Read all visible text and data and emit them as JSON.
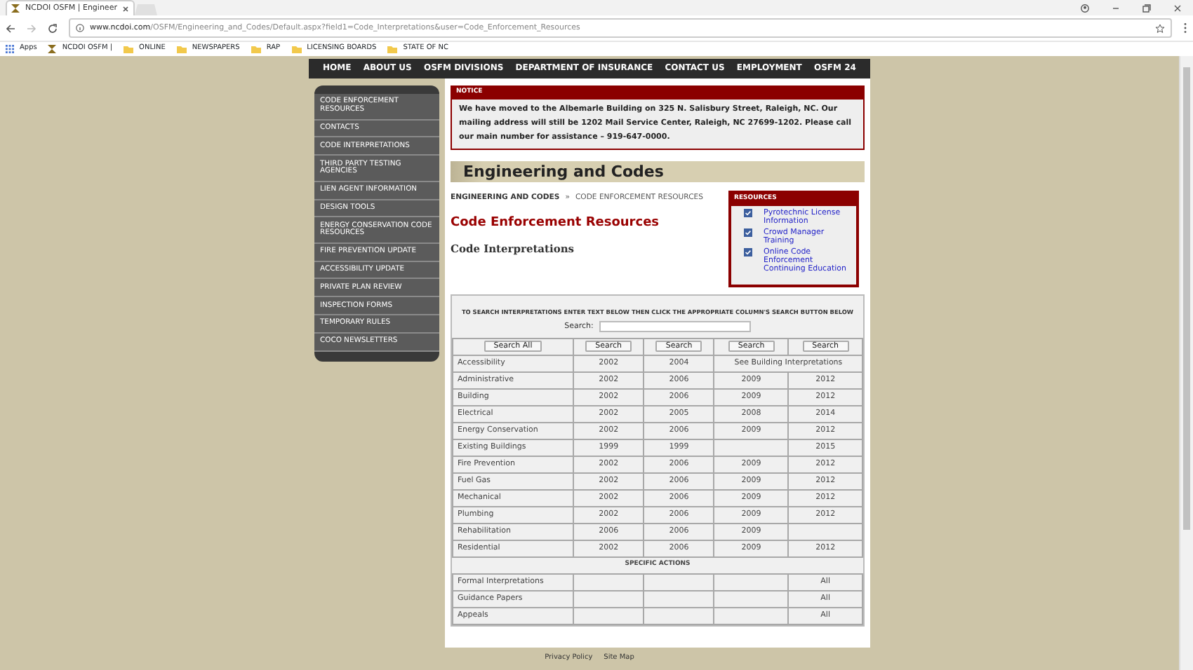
{
  "browser": {
    "tab_title": "NCDOI OSFM | Engineer",
    "url_host": "www.ncdoi.com",
    "url_path": "/OSFM/Engineering_and_Codes/Default.aspx?field1=Code_Interpretations&user=Code_Enforcement_Resources",
    "bookmarks": [
      {
        "kind": "apps",
        "label": "Apps"
      },
      {
        "kind": "site",
        "label": "NCDOI OSFM |"
      },
      {
        "kind": "folder",
        "label": "ONLINE"
      },
      {
        "kind": "folder",
        "label": "NEWSPAPERS"
      },
      {
        "kind": "folder",
        "label": "RAP"
      },
      {
        "kind": "folder",
        "label": "LICENSING BOARDS"
      },
      {
        "kind": "folder",
        "label": "STATE OF NC"
      }
    ]
  },
  "nav": [
    "HOME",
    "ABOUT US",
    "OSFM DIVISIONS",
    "DEPARTMENT OF INSURANCE",
    "CONTACT US",
    "EMPLOYMENT",
    "OSFM 24"
  ],
  "sidebar": {
    "items": [
      "CODE ENFORCEMENT RESOURCES",
      "CONTACTS",
      "CODE INTERPRETATIONS",
      "THIRD PARTY TESTING AGENCIES",
      "LIEN AGENT INFORMATION",
      "DESIGN TOOLS",
      "ENERGY CONSERVATION CODE RESOURCES",
      "FIRE PREVENTION UPDATE",
      "ACCESSIBILITY UPDATE",
      "PRIVATE PLAN REVIEW",
      "INSPECTION FORMS",
      "TEMPORARY RULES",
      "COCO NEWSLETTERS"
    ]
  },
  "notice": {
    "title": "NOTICE",
    "text": "We have moved to the Albemarle Building on 325 N. Salisbury Street, Raleigh, NC. Our mailing address will still be 1202 Mail Service Center, Raleigh, NC 27699-1202. Please call our main number for assistance – 919-647-0000."
  },
  "page_title": "Engineering and Codes",
  "breadcrumb": {
    "link": "ENGINEERING AND CODES",
    "separator": "»",
    "current": "CODE ENFORCEMENT RESOURCES"
  },
  "heading": "Code Enforcement Resources",
  "subheading": "Code Interpretations",
  "resources": {
    "title": "RESOURCES",
    "items": [
      {
        "label": "Pyrotechnic License Information",
        "checked": true
      },
      {
        "label": "Crowd Manager Training",
        "checked": true
      },
      {
        "label": "Online Code Enforcement Continuing Education",
        "checked": true
      }
    ]
  },
  "search": {
    "instruction": "TO SEARCH INTERPRETATIONS ENTER TEXT BELOW THEN CLICK THE APPROPRIATE COLUMN'S SEARCH BUTTON BELOW",
    "label": "Search:",
    "buttons": [
      "Search All",
      "Search",
      "Search",
      "Search",
      "Search"
    ]
  },
  "table": {
    "rows": [
      {
        "name": "Accessibility",
        "col_1": "2002",
        "col_2": "2004",
        "note": "See Building Interpretations"
      },
      {
        "name": "Administrative",
        "col_1": "2002",
        "col_2": "2006",
        "col_3": "2009",
        "col_4": "2012"
      },
      {
        "name": "Building",
        "col_1": "2002",
        "col_2": "2006",
        "col_3": "2009",
        "col_4": "2012"
      },
      {
        "name": "Electrical",
        "col_1": "2002",
        "col_2": "2005",
        "col_3": "2008",
        "col_4": "2014"
      },
      {
        "name": "Energy Conservation",
        "col_1": "2002",
        "col_2": "2006",
        "col_3": "2009",
        "col_4": "2012"
      },
      {
        "name": "Existing Buildings",
        "col_1": "1999",
        "col_2": "1999",
        "col_4": "2015"
      },
      {
        "name": "Fire Prevention",
        "col_1": "2002",
        "col_2": "2006",
        "col_3": "2009",
        "col_4": "2012"
      },
      {
        "name": "Fuel Gas",
        "col_1": "2002",
        "col_2": "2006",
        "col_3": "2009",
        "col_4": "2012"
      },
      {
        "name": "Mechanical",
        "col_1": "2002",
        "col_2": "2006",
        "col_3": "2009",
        "col_4": "2012"
      },
      {
        "name": "Plumbing",
        "col_1": "2002",
        "col_2": "2006",
        "col_3": "2009",
        "col_4": "2012"
      },
      {
        "name": "Rehabilitation",
        "col_1": "2006",
        "col_2": "2006",
        "col_3": "2009"
      },
      {
        "name": "Residential",
        "col_1": "2002",
        "col_2": "2006",
        "col_3": "2009",
        "col_4": "2012"
      }
    ],
    "section_title": "SPECIFIC ACTIONS",
    "actions": [
      {
        "name": "Formal Interpretations",
        "col_4": "All"
      },
      {
        "name": "Guidance Papers",
        "col_4": "All"
      },
      {
        "name": "Appeals",
        "col_4": "All"
      }
    ]
  },
  "footer": [
    "Privacy Policy",
    "Site Map"
  ]
}
